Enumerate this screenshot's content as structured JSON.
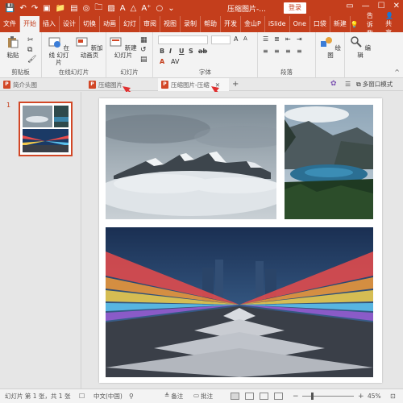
{
  "titlebar": {
    "doc_title": "压缩图片-...",
    "login_label": "登录",
    "ctrl_min": "—",
    "ctrl_max": "☐",
    "ctrl_close": "✕"
  },
  "ribbon_tabs": [
    "文件",
    "开始",
    "插入",
    "设计",
    "切换",
    "动画",
    "幻灯",
    "审阅",
    "视图",
    "录制",
    "帮助",
    "开发",
    "金山P",
    "iSlide",
    "One",
    "口袋",
    "新建",
    "告诉我"
  ],
  "share_label": "共享",
  "ribbon": {
    "paste_label": "粘贴",
    "clipboard_label": "剪贴板",
    "online_slides_label": "在线 幻灯片",
    "new_animation_label": "新加 动画页",
    "online_group_label": "在线幻灯片",
    "new_slide_label": "新建 幻灯片",
    "slides_group_label": "幻灯片",
    "font_group_label": "字体",
    "para_group_label": "段落",
    "drawing_label": "绘图",
    "editing_label": "编辑",
    "bold": "B",
    "italic": "I",
    "underline": "U",
    "strike": "S",
    "ab": "ab"
  },
  "doc_tabs": {
    "tab1": "简介头图",
    "tab2": "压缩图片",
    "tab3": "压缩图片-压缩",
    "close": "✕",
    "add": "+",
    "multi_window": "多窗口模式"
  },
  "slide_panel": {
    "slide_number": "1"
  },
  "status": {
    "slide_info": "幻灯片 第 1 张，共 1 张",
    "language": "中文(中国)",
    "notes": "备注",
    "comments": "批注",
    "zoom_minus": "−",
    "zoom_plus": "+",
    "zoom_level": "45%",
    "zoom_fraction": 0.45
  },
  "colors": {
    "accent": "#c43e1c",
    "ppt_red": "#d24726",
    "arrow_red": "#e03030"
  }
}
